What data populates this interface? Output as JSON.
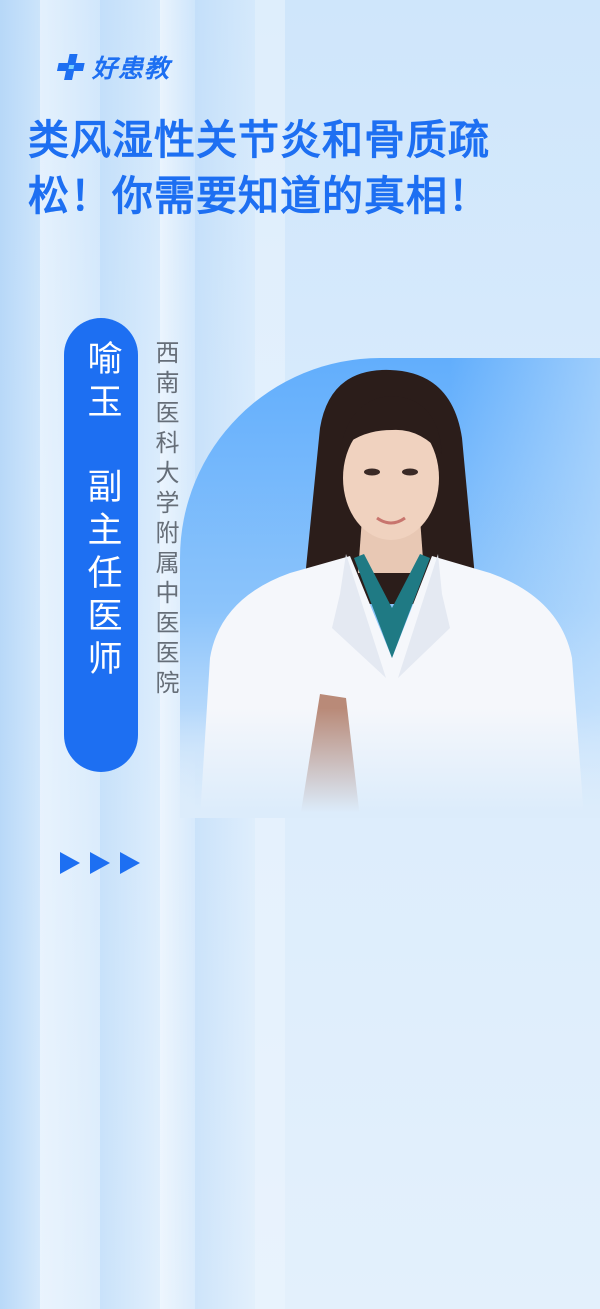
{
  "brand": {
    "name": "好患教",
    "icon": "medical-cross-logo-icon"
  },
  "title": {
    "line1": "类风湿性关节炎和骨质疏",
    "line2": "松！你需要知道的真相！"
  },
  "doctor": {
    "name": "喻玉",
    "position": "副主任医师",
    "hospital": "西南医科大学附属中医医院"
  },
  "decor": {
    "arrow_icon": "play-triangle-icon"
  },
  "colors": {
    "accent": "#1d6ff2",
    "background": "#dcecfb",
    "hospital_text": "#666e78"
  }
}
